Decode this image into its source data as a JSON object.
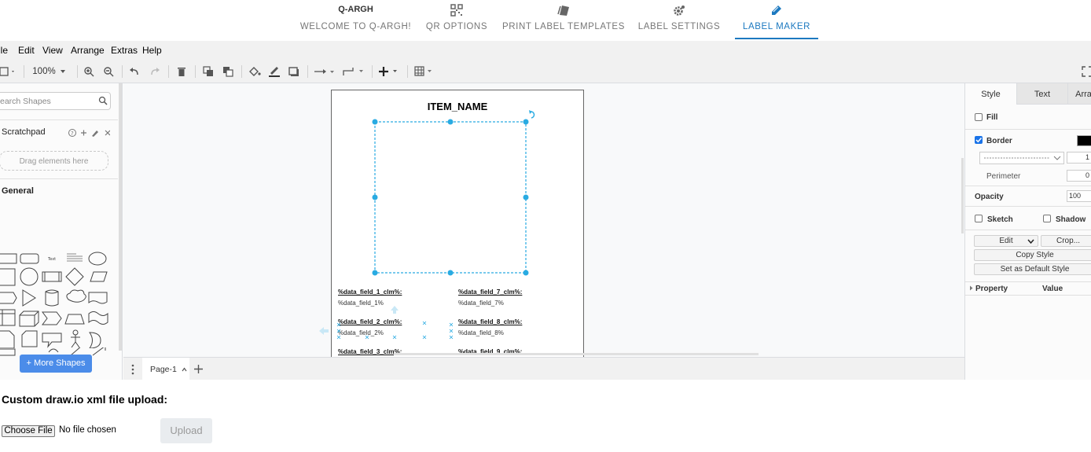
{
  "nav": {
    "tabs": [
      {
        "label": "WELCOME TO Q-ARGH!",
        "icon": "q-argh-logo-icon",
        "logo_text": "Q-ARGH"
      },
      {
        "label": "QR OPTIONS",
        "icon": "qr-code-icon"
      },
      {
        "label": "PRINT LABEL TEMPLATES",
        "icon": "label-stack-icon"
      },
      {
        "label": "LABEL SETTINGS",
        "icon": "gear-icon"
      },
      {
        "label": "LABEL MAKER",
        "icon": "pencil-ruler-icon",
        "active": true
      }
    ],
    "active_color": "#1c79c0"
  },
  "menubar": [
    "ile",
    "Edit",
    "View",
    "Arrange",
    "Extras",
    "Help"
  ],
  "toolbar": {
    "zoom": "100%"
  },
  "left_panel": {
    "search_placeholder": "earch Shapes",
    "scratchpad_title": "Scratchpad",
    "scratchpad_drop": "Drag elements here",
    "general_title": "General",
    "more_shapes": "+ More Shapes"
  },
  "canvas": {
    "item_name": "ITEM_NAME",
    "fields": [
      {
        "head": "%data_field_1_clm%:",
        "value": "%data_field_1%"
      },
      {
        "head": "%data_field_2_clm%:",
        "value": "%data_field_2%"
      },
      {
        "head": "%data_field_3_clm%:",
        "value": ""
      },
      {
        "head": "%data_field_7_clm%:",
        "value": "%data_field_7%"
      },
      {
        "head": "%data_field_8_clm%:",
        "value": "%data_field_8%"
      },
      {
        "head": "%data_field_9_clm%:",
        "value": ""
      }
    ],
    "selection_color": "#29abe2"
  },
  "page_tab": "Page-1",
  "right_panel": {
    "tabs": [
      "Style",
      "Text",
      "Arra"
    ],
    "fill": "Fill",
    "border": "Border",
    "border_width": "1",
    "perimeter": "Perimeter",
    "perimeter_value": "0",
    "opacity": "Opacity",
    "opacity_value": "100",
    "sketch": "Sketch",
    "shadow": "Shadow",
    "edit": "Edit",
    "crop": "Crop...",
    "copy_style": "Copy Style",
    "set_default": "Set as Default Style",
    "property": "Property",
    "value": "Value"
  },
  "upload": {
    "title": "Custom draw.io xml file upload:",
    "choose_file": "Choose File",
    "no_file": "No file chosen",
    "upload_button": "Upload"
  }
}
